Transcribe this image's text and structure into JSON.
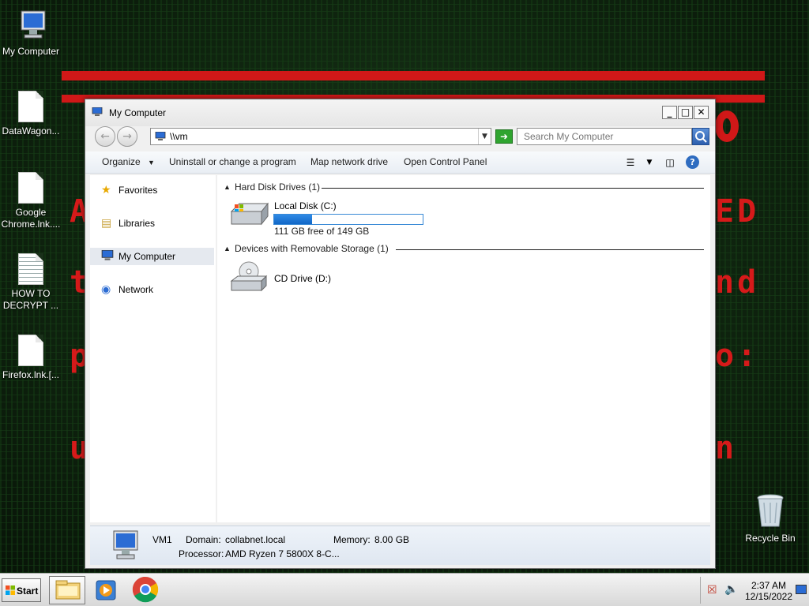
{
  "desktop": {
    "icons": [
      {
        "label": "My Computer",
        "icon": "computer-icon"
      },
      {
        "label": "DataWagon...",
        "icon": "document-icon"
      },
      {
        "label": "Google Chrome.lnk....",
        "icon": "document-icon"
      },
      {
        "label": "HOW TO DECRYPT ...",
        "icon": "text-file-icon"
      },
      {
        "label": "Firefox.lnk.[...",
        "icon": "document-icon"
      },
      {
        "label": "Recycle Bin",
        "icon": "recycle-bin-icon"
      }
    ],
    "wallpaper_accent": "#d01818"
  },
  "window": {
    "title": "My Computer",
    "minimize_label": "_",
    "maximize_label": "□",
    "close_label": "✕",
    "address_value": "\\\\vm",
    "search_placeholder": "Search My Computer",
    "toolbar": {
      "organize": "Organize",
      "uninstall": "Uninstall or change a program",
      "map_drive": "Map network drive",
      "control_panel": "Open Control Panel",
      "help": "?"
    },
    "nav": [
      {
        "label": "Favorites",
        "icon": "star-icon"
      },
      {
        "label": "Libraries",
        "icon": "libraries-icon"
      },
      {
        "label": "My Computer",
        "icon": "computer-icon",
        "selected": true
      },
      {
        "label": "Network",
        "icon": "network-icon"
      }
    ],
    "groups": {
      "hard_disks": "Hard Disk Drives (1)",
      "removable": "Devices with Removable Storage (1)"
    },
    "drives": [
      {
        "name": "Local Disk (C:)",
        "free_text": "111 GB free of 149 GB",
        "used_fraction": 0.255
      },
      {
        "name": "CD Drive (D:)"
      }
    ],
    "details": {
      "computer_name": "VM1",
      "domain_label": "Domain:",
      "domain_value": "collabnet.local",
      "memory_label": "Memory:",
      "memory_value": "8.00 GB",
      "processor_label": "Processor:",
      "processor_value": "AMD Ryzen 7 5800X 8-C..."
    }
  },
  "taskbar": {
    "start_label": "Start",
    "apps": [
      "explorer-icon",
      "media-player-icon",
      "chrome-icon"
    ],
    "clock_time": "2:37 AM",
    "clock_date": "12/15/2022"
  }
}
